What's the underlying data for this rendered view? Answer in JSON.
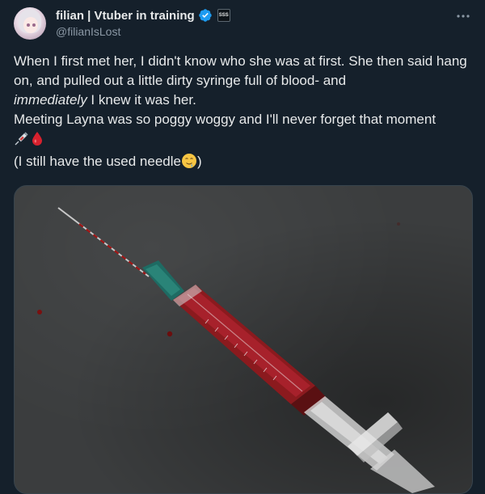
{
  "author": {
    "display_name": "filian | Vtuber in training",
    "handle": "@filianIsLost",
    "verified": true,
    "affiliate_badge_text": "SSS"
  },
  "tweet": {
    "line1": "When I first met her, I didn't know who she was at first. She then said hang on, and pulled out a little dirty syringe full of blood- and",
    "line2_emph": "immediately",
    "line2_rest": " I knew it was her.",
    "line3": "Meeting Layna was so poggy woggy and I'll never forget that moment",
    "line5_pre": "(I still have the used needle",
    "line5_post": ")"
  },
  "icons": {
    "verified": "verified-badge-icon",
    "more": "more-options-icon",
    "syringe_emoji": "syringe-emoji-icon",
    "blood_emoji": "drop-of-blood-emoji-icon",
    "drool_emoji": "drooling-face-emoji-icon"
  },
  "media": {
    "alt": "Photo of a syringe filled with blood on a dark slate surface"
  },
  "colors": {
    "background": "#15202b",
    "text": "#e7e9ea",
    "secondary": "#8b98a5",
    "verified": "#1d9bf0"
  }
}
